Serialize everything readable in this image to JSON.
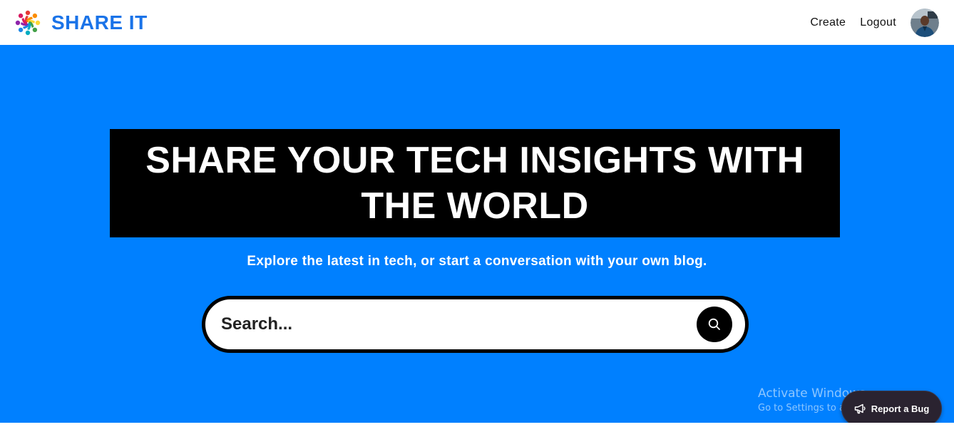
{
  "header": {
    "brand_name": "SHARE IT",
    "nav": [
      {
        "label": "Create"
      },
      {
        "label": "Logout"
      }
    ],
    "avatar_icon": "user-avatar"
  },
  "hero": {
    "headline": "SHARE YOUR TECH INSIGHTS WITH THE WORLD",
    "subtitle": "Explore the latest in tech, or start a conversation with your own blog.",
    "search": {
      "placeholder": "Search...",
      "value": "",
      "button_icon": "search-icon"
    }
  },
  "watermark": {
    "title": "Activate Windows",
    "subtitle": "Go to Settings to activate Windows."
  },
  "report_bug": {
    "label": "Report a Bug",
    "icon": "megaphone-icon"
  },
  "colors": {
    "brand": "#1a73e8",
    "hero_bg": "#0080ff",
    "headline_bg": "#000000"
  }
}
